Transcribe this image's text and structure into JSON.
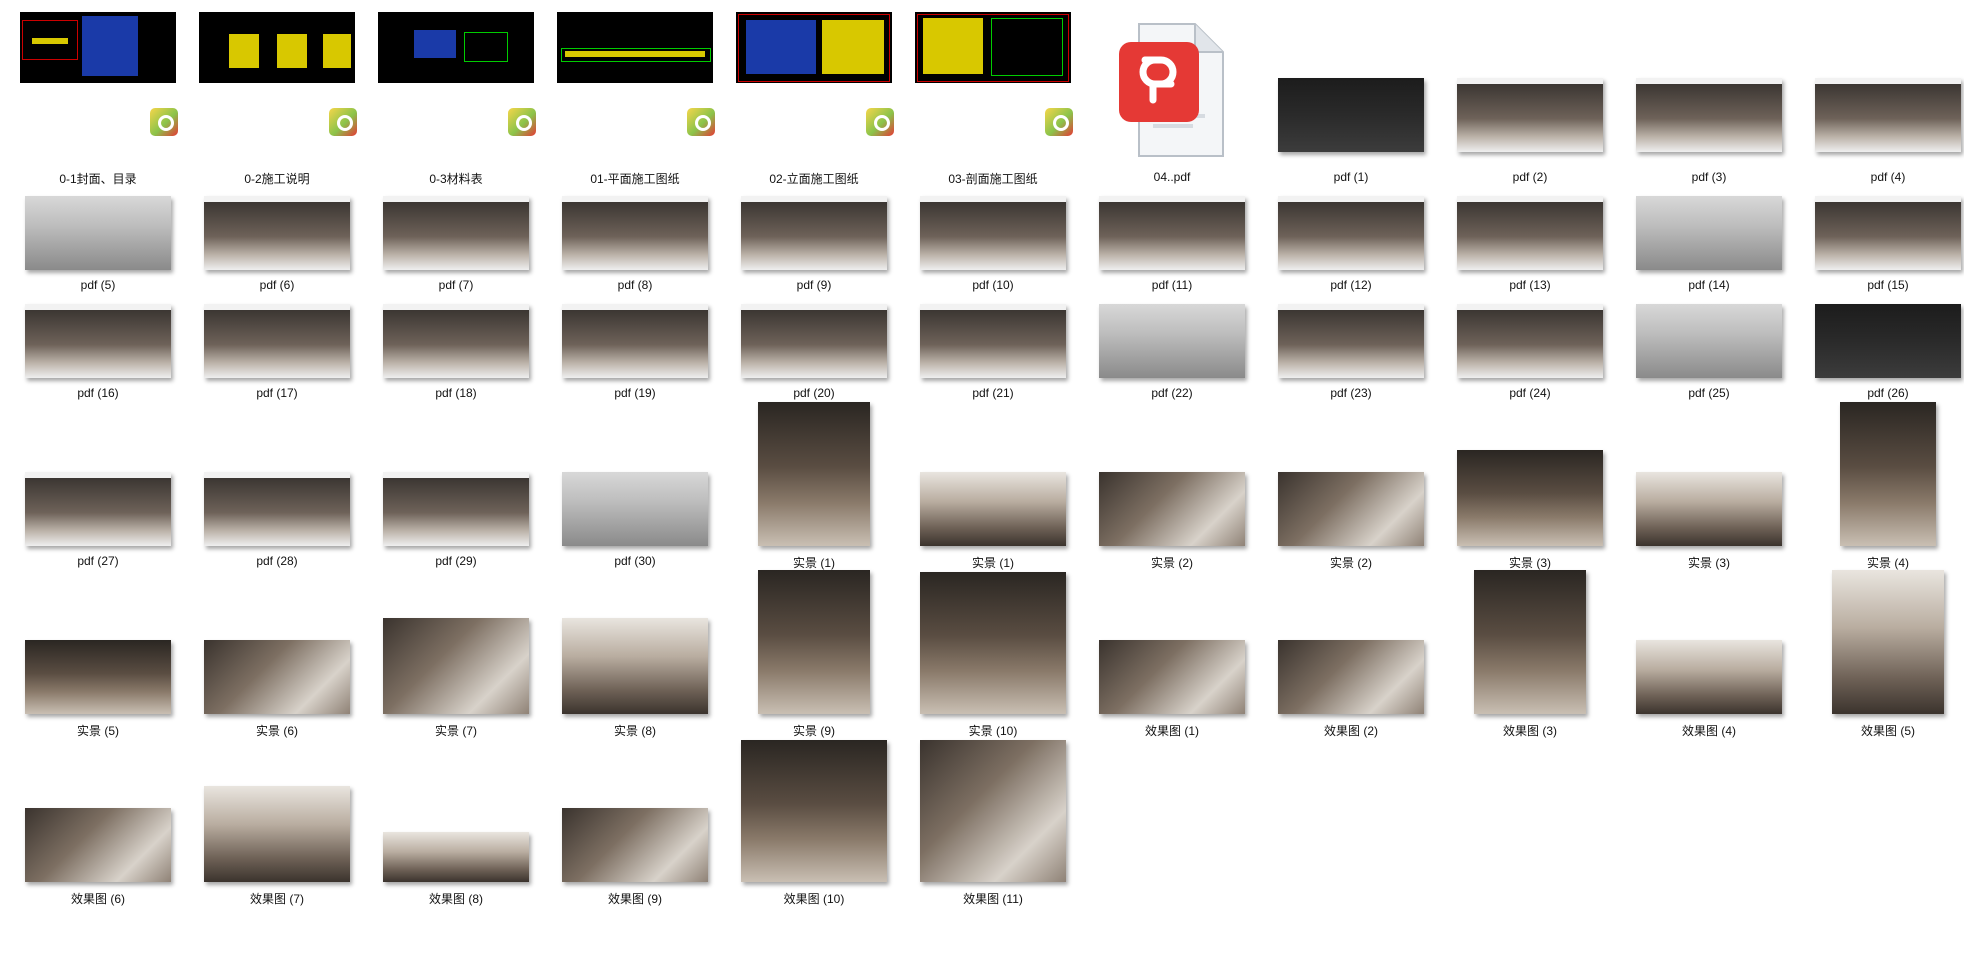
{
  "items": [
    {
      "label": "0-1封面、目录",
      "kind": "cad"
    },
    {
      "label": "0-2施工说明",
      "kind": "cad"
    },
    {
      "label": "0-3材料表",
      "kind": "cad"
    },
    {
      "label": "01-平面施工图纸",
      "kind": "cad"
    },
    {
      "label": "02-立面施工图纸",
      "kind": "cad"
    },
    {
      "label": "03-剖面施工图纸",
      "kind": "cad"
    },
    {
      "label": "04..pdf",
      "kind": "pdf-icon"
    },
    {
      "label": "pdf (1)",
      "kind": "pdf-dark"
    },
    {
      "label": "pdf (2)",
      "kind": "pdf"
    },
    {
      "label": "pdf (3)",
      "kind": "pdf"
    },
    {
      "label": "pdf (4)",
      "kind": "pdf"
    },
    {
      "label": "pdf (5)",
      "kind": "pdf-gray"
    },
    {
      "label": "pdf (6)",
      "kind": "pdf"
    },
    {
      "label": "pdf (7)",
      "kind": "pdf"
    },
    {
      "label": "pdf (8)",
      "kind": "pdf"
    },
    {
      "label": "pdf (9)",
      "kind": "pdf"
    },
    {
      "label": "pdf (10)",
      "kind": "pdf"
    },
    {
      "label": "pdf (11)",
      "kind": "pdf"
    },
    {
      "label": "pdf (12)",
      "kind": "pdf"
    },
    {
      "label": "pdf (13)",
      "kind": "pdf"
    },
    {
      "label": "pdf (14)",
      "kind": "pdf-gray"
    },
    {
      "label": "pdf (15)",
      "kind": "pdf"
    },
    {
      "label": "pdf (16)",
      "kind": "pdf"
    },
    {
      "label": "pdf (17)",
      "kind": "pdf"
    },
    {
      "label": "pdf (18)",
      "kind": "pdf"
    },
    {
      "label": "pdf (19)",
      "kind": "pdf"
    },
    {
      "label": "pdf (20)",
      "kind": "pdf"
    },
    {
      "label": "pdf (21)",
      "kind": "pdf"
    },
    {
      "label": "pdf (22)",
      "kind": "pdf-gray"
    },
    {
      "label": "pdf (23)",
      "kind": "pdf"
    },
    {
      "label": "pdf (24)",
      "kind": "pdf"
    },
    {
      "label": "pdf (25)",
      "kind": "pdf-gray"
    },
    {
      "label": "pdf (26)",
      "kind": "pdf-dark"
    },
    {
      "label": "pdf (27)",
      "kind": "pdf"
    },
    {
      "label": "pdf (28)",
      "kind": "pdf"
    },
    {
      "label": "pdf (29)",
      "kind": "pdf"
    },
    {
      "label": "pdf (30)",
      "kind": "pdf-gray"
    },
    {
      "label": "实景 (1)",
      "kind": "photo-dark",
      "shape": "portrait"
    },
    {
      "label": "实景 (1)",
      "kind": "photo-light"
    },
    {
      "label": "实景 (2)",
      "kind": "photo-mid"
    },
    {
      "label": "实景 (2)",
      "kind": "photo-mid"
    },
    {
      "label": "实景 (3)",
      "kind": "photo-dark",
      "shape": "tall-landscape"
    },
    {
      "label": "实景 (3)",
      "kind": "photo-light"
    },
    {
      "label": "实景 (4)",
      "kind": "photo-dark",
      "shape": "narrow"
    },
    {
      "label": "实景 (5)",
      "kind": "photo-dark"
    },
    {
      "label": "实景 (6)",
      "kind": "photo-mid"
    },
    {
      "label": "实景 (7)",
      "kind": "photo-mid",
      "shape": "tall-landscape"
    },
    {
      "label": "实景 (8)",
      "kind": "photo-light",
      "shape": "tall-landscape"
    },
    {
      "label": "实景 (9)",
      "kind": "photo-dark",
      "shape": "portrait"
    },
    {
      "label": "实景 (10)",
      "kind": "photo-dark",
      "shape": "square"
    },
    {
      "label": "效果图 (1)",
      "kind": "photo-mid"
    },
    {
      "label": "效果图 (2)",
      "kind": "photo-mid"
    },
    {
      "label": "效果图 (3)",
      "kind": "photo-dark",
      "shape": "portrait"
    },
    {
      "label": "效果图 (4)",
      "kind": "photo-light"
    },
    {
      "label": "效果图 (5)",
      "kind": "photo-light",
      "shape": "portrait"
    },
    {
      "label": "效果图 (6)",
      "kind": "photo-mid"
    },
    {
      "label": "效果图 (7)",
      "kind": "photo-light",
      "shape": "tall-landscape"
    },
    {
      "label": "效果图 (8)",
      "kind": "photo-light",
      "shape": "short"
    },
    {
      "label": "效果图 (9)",
      "kind": "photo-mid"
    },
    {
      "label": "效果图 (10)",
      "kind": "photo-dark",
      "shape": "square"
    },
    {
      "label": "效果图 (11)",
      "kind": "photo-mid",
      "shape": "square"
    }
  ]
}
